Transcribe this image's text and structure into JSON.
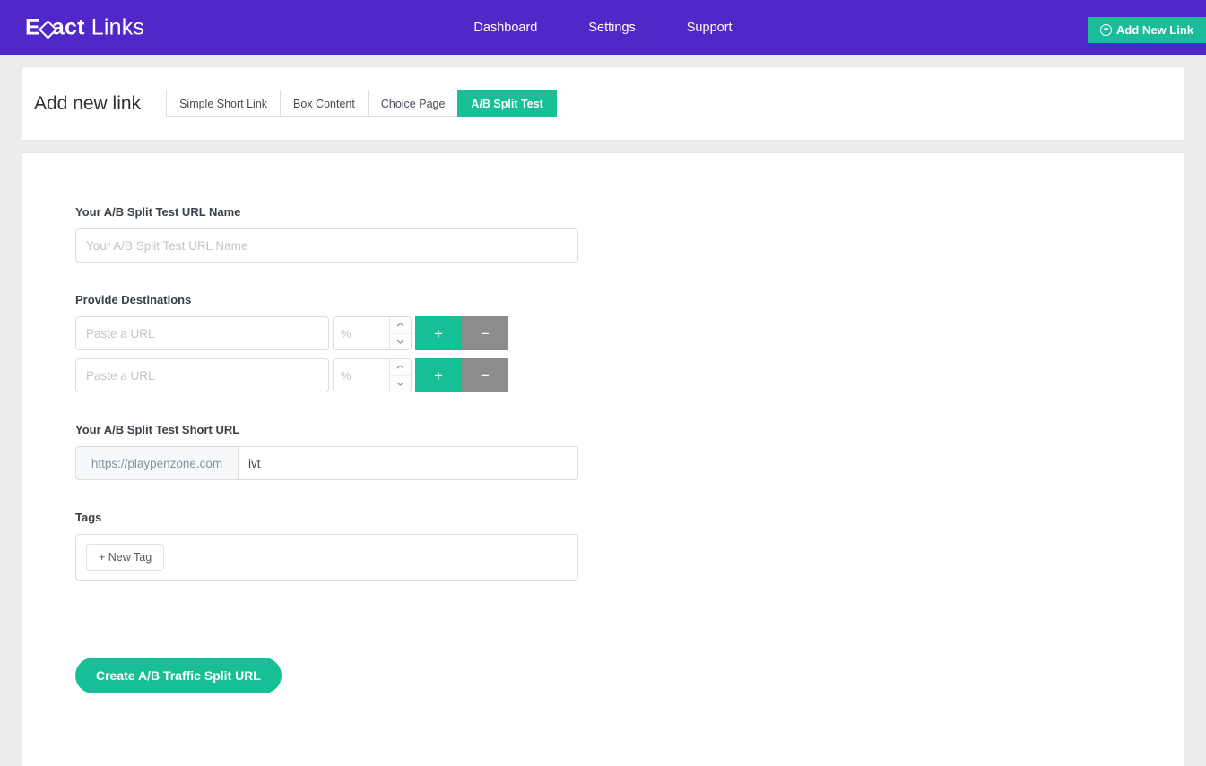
{
  "header": {
    "brand_bold": "E",
    "brand_bold_rest": "act",
    "brand_light": "Links",
    "nav": [
      {
        "label": "Dashboard"
      },
      {
        "label": "Settings"
      },
      {
        "label": "Support"
      }
    ],
    "add_new_link_label": "Add New Link",
    "add_new_link_icon": "circle-plus-icon",
    "colors": {
      "navbar_purple": "#5128c8",
      "accent_green": "#17bf96",
      "muted_gray": "#8c8c8c",
      "page_background": "#ececec"
    }
  },
  "card_header": {
    "page_title": "Add new link",
    "tabs": [
      {
        "label": "Simple Short Link",
        "active": false
      },
      {
        "label": "Box Content",
        "active": false
      },
      {
        "label": "Choice Page",
        "active": false
      },
      {
        "label": "A/B Split Test",
        "active": true
      }
    ]
  },
  "form": {
    "url_name": {
      "label": "Your A/B Split Test URL Name",
      "placeholder": "Your A/B Split Test URL Name",
      "value": ""
    },
    "destinations": {
      "label": "Provide Destinations",
      "rows": [
        {
          "url_placeholder": "Paste a URL",
          "url_value": "",
          "percent_placeholder": "%",
          "percent_value": "",
          "add_label": "+",
          "remove_label": "−"
        },
        {
          "url_placeholder": "Paste a URL",
          "url_value": "",
          "percent_placeholder": "%",
          "percent_value": "",
          "add_label": "+",
          "remove_label": "−"
        }
      ]
    },
    "short_url": {
      "label": "Your A/B Split Test Short URL",
      "prefix": "https://playpenzone.com",
      "value": "ivt",
      "placeholder": ""
    },
    "tags": {
      "label": "Tags",
      "new_tag_label": "+ New Tag"
    },
    "submit_label": "Create A/B Traffic Split URL"
  }
}
